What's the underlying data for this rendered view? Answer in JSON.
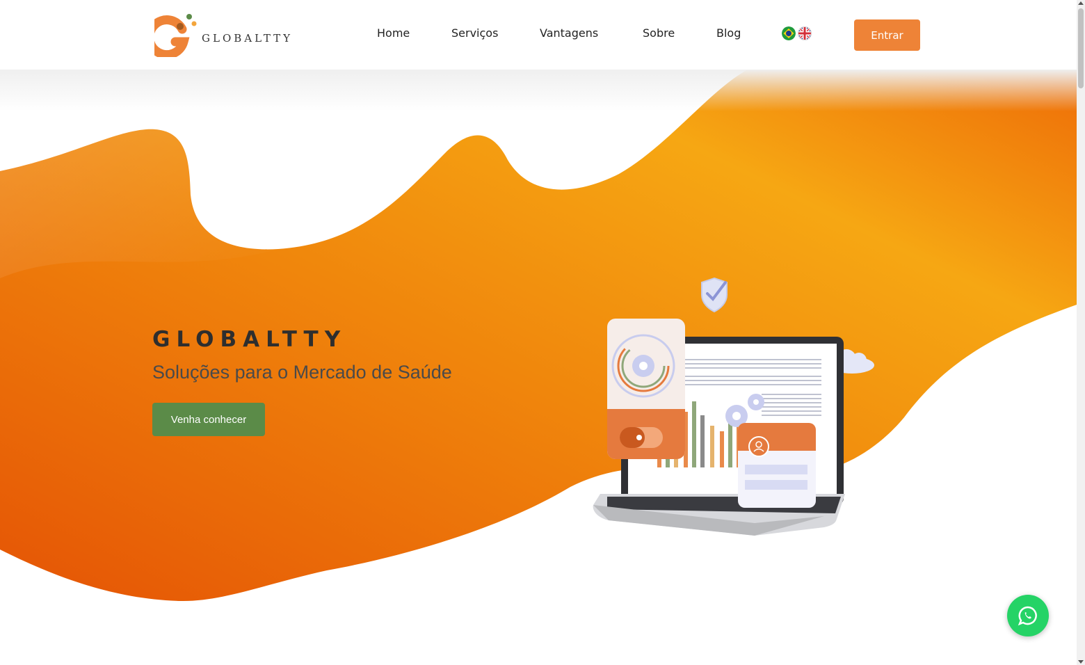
{
  "brand": {
    "name": "GLOBALTTY",
    "colors": {
      "orange": "#ee8337",
      "green": "#5b8b48",
      "brown": "#a35a1f"
    }
  },
  "nav": {
    "items": [
      {
        "label": "Home"
      },
      {
        "label": "Serviços"
      },
      {
        "label": "Vantagens"
      },
      {
        "label": "Sobre"
      },
      {
        "label": "Blog"
      }
    ],
    "languages": [
      "brazil-flag-icon",
      "uk-flag-icon"
    ],
    "login_label": "Entrar"
  },
  "hero": {
    "title": "GLOBALTTY",
    "subtitle": "Soluções para o Mercado de Saúde",
    "cta_label": "Venha conhecer"
  },
  "floating": {
    "icon": "whatsapp-icon",
    "color": "#25d366"
  }
}
